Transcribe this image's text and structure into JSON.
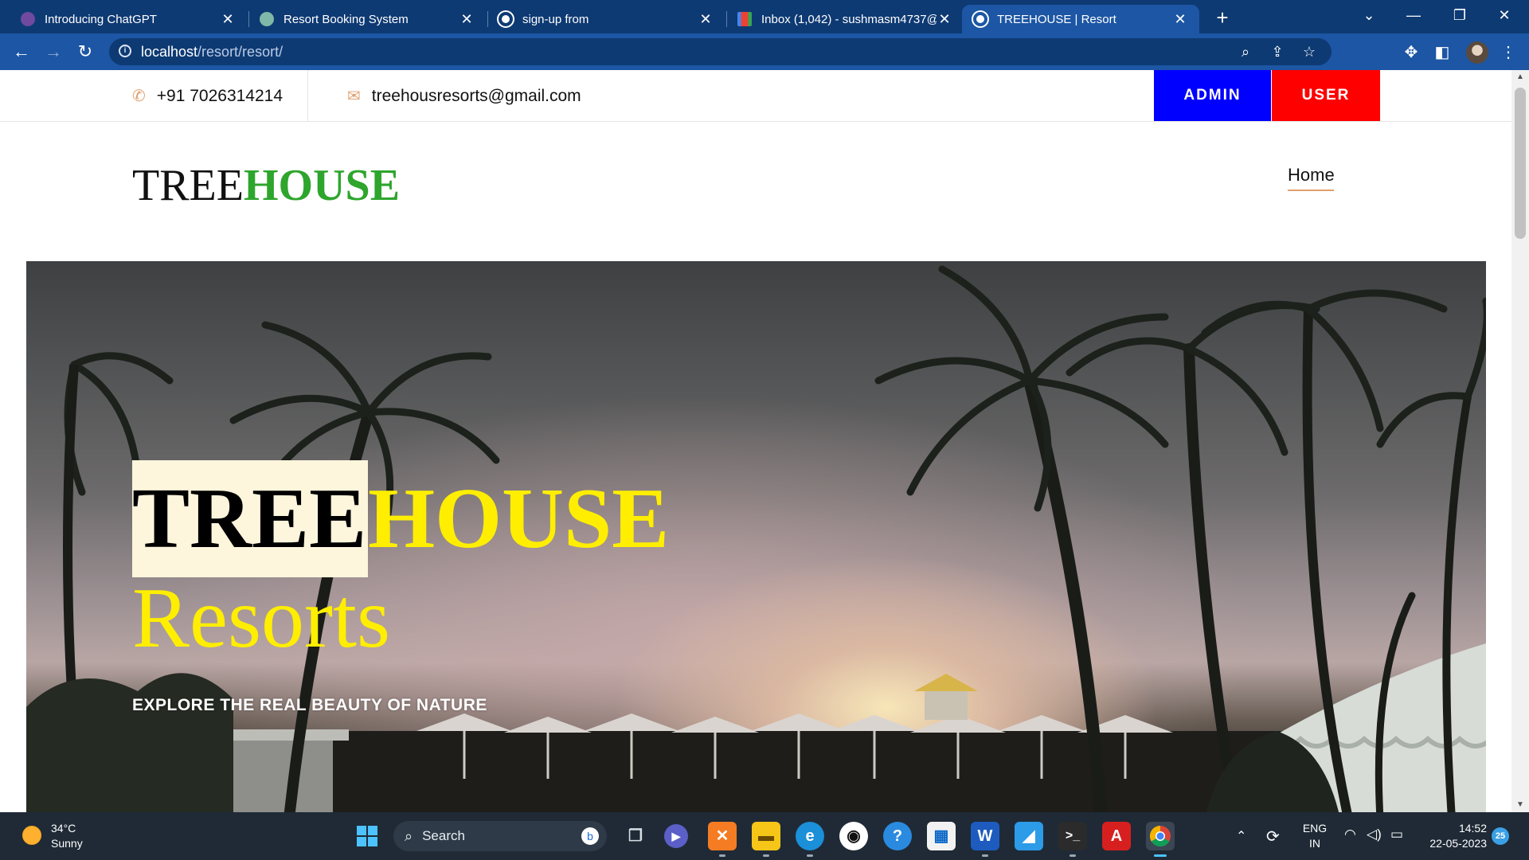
{
  "browser": {
    "tabs": [
      {
        "title": "Introducing ChatGPT",
        "icon": "chatgpt-icon",
        "active": false
      },
      {
        "title": "Resort Booking System",
        "icon": "chatgpt-icon",
        "active": false
      },
      {
        "title": "sign-up from",
        "icon": "globe-icon",
        "active": false
      },
      {
        "title": "Inbox (1,042) - sushmasm4737@",
        "icon": "gmail-icon",
        "active": false
      },
      {
        "title": "TREEHOUSE | Resort",
        "icon": "globe-icon",
        "active": true
      }
    ],
    "url_host": "localhost",
    "url_path": "/resort/resort/"
  },
  "page": {
    "topbar": {
      "phone": "+91 7026314214",
      "email": "treehousresorts@gmail.com",
      "admin_label": "ADMIN",
      "user_label": "USER"
    },
    "brand": {
      "part1": "TREE",
      "part2": "HOUSE"
    },
    "nav": {
      "home": "Home"
    },
    "hero": {
      "title_part1": "TREE",
      "title_part2": "HOUSE",
      "subtitle": "Resorts",
      "tagline": "EXPLORE THE REAL BEAUTY OF NATURE"
    },
    "colors": {
      "admin": "#0000ff",
      "user": "#ff0000",
      "brand_green": "#2ea52c",
      "hero_yellow": "#ffee00"
    }
  },
  "taskbar": {
    "weather_temp": "34°C",
    "weather_desc": "Sunny",
    "search_label": "Search",
    "lang_top": "ENG",
    "lang_bottom": "IN",
    "time": "14:52",
    "date": "22-05-2023",
    "notifications": "25"
  }
}
